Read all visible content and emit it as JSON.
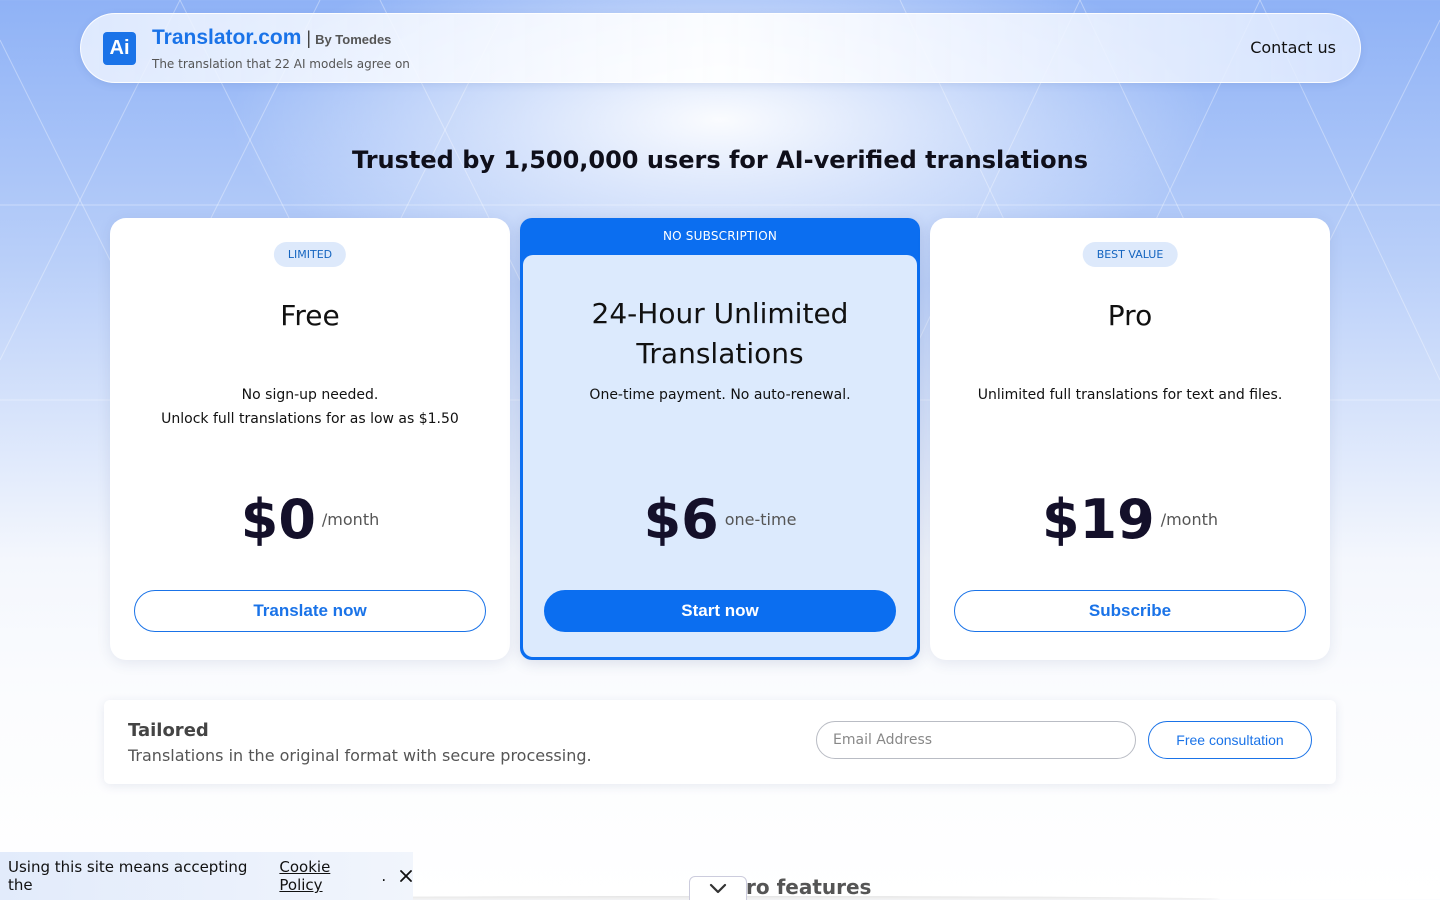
{
  "header": {
    "logo_text": "Ai",
    "brand_name": "Translator.com",
    "separator": "|",
    "brand_by": "By Tomedes",
    "tagline": "The translation that 22 AI models agree on",
    "contact_label": "Contact us"
  },
  "headline": "Trusted by 1,500,000 users for AI-verified translations",
  "plans": {
    "free": {
      "badge": "LIMITED",
      "title": "Free",
      "desc_line1": "No sign-up needed.",
      "desc_line2": "Unlock full translations for as low as $1.50",
      "price": "$0",
      "period": "/month",
      "button": "Translate now"
    },
    "unlimited": {
      "ribbon": "NO SUBSCRIPTION",
      "title_line1": "24-Hour Unlimited",
      "title_line2": "Translations",
      "desc": "One-time payment. No auto-renewal.",
      "price": "$6",
      "period": "one-time",
      "button": "Start now"
    },
    "pro": {
      "badge": "BEST VALUE",
      "title": "Pro",
      "desc": "Unlimited full translations for text and files.",
      "price": "$19",
      "period": "/month",
      "button": "Subscribe"
    }
  },
  "tailored": {
    "title": "Tailored",
    "desc": "Translations in the original format with secure processing.",
    "email_placeholder": "Email Address",
    "consult_button": "Free consultation"
  },
  "features_heading": "ro features",
  "cookie": {
    "text": "Using this site means accepting the",
    "link": "Cookie Policy",
    "period": "."
  },
  "colors": {
    "accent": "#1a73e8",
    "accent_solid": "#0b6ef0",
    "featured_card_bg": "#dceafd",
    "badge_bg": "#dde9fb"
  }
}
